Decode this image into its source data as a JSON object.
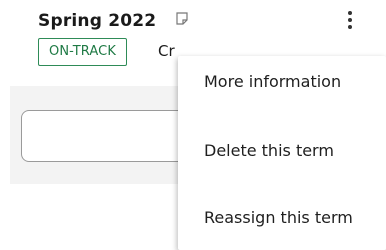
{
  "term": {
    "title": "Spring 2022",
    "status": "ON-TRACK",
    "credits_label": "Cr"
  },
  "icons": {
    "note": "note-icon",
    "more": "more-vertical-icon"
  },
  "menu": {
    "items": [
      {
        "label": "More information"
      },
      {
        "label": "Delete this term"
      },
      {
        "label": "Reassign this term"
      }
    ]
  },
  "colors": {
    "status_green": "#1f7a45",
    "panel_bg": "#f3f3f3"
  }
}
